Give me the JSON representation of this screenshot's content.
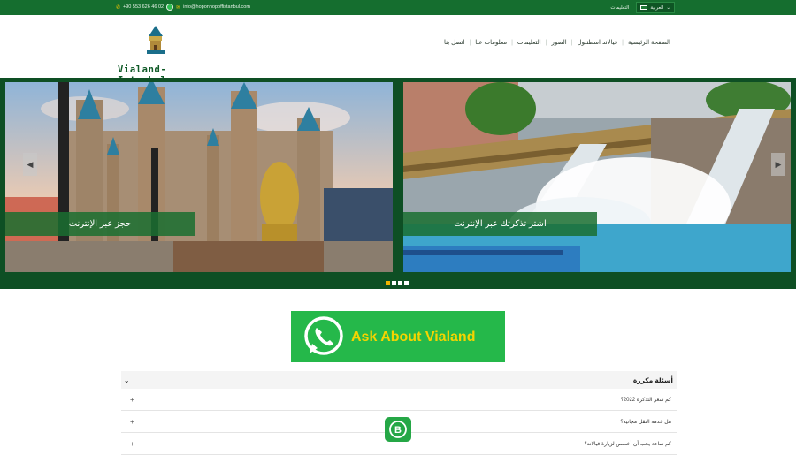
{
  "topbar": {
    "phone": "+90 553 626 46 02",
    "email": "info@hoponhopoffistanbul.com",
    "lang_label": "العربية",
    "login_label": "التعليمات"
  },
  "header": {
    "logo_text": "Vialand-Istanbul.com",
    "nav": [
      "اتصل بنا",
      "معلومات عنا",
      "التعليمات",
      "الصور",
      "فيالاند اسطنبول",
      "الصفحة الرئيسية"
    ]
  },
  "slider": {
    "caption_left": "حجز عبر الإنترنت",
    "caption_right": "اشتر تذكرتك عبر الإنترنت",
    "dots": 4,
    "active_dot": 1
  },
  "whatsapp_banner": {
    "label": "Ask About Vialand"
  },
  "faq": {
    "title": "أسئلة مكررة",
    "items": [
      "كم سعر التذكرة 2022؟",
      "هل خدمة النقل مجانية؟",
      "كم ساعة يجب أن أخصص لزيارة فيالاند؟"
    ]
  },
  "colors": {
    "brand_green": "#156e2f",
    "accent_yellow": "#f5d400",
    "whatsapp_green": "#25b84a"
  }
}
